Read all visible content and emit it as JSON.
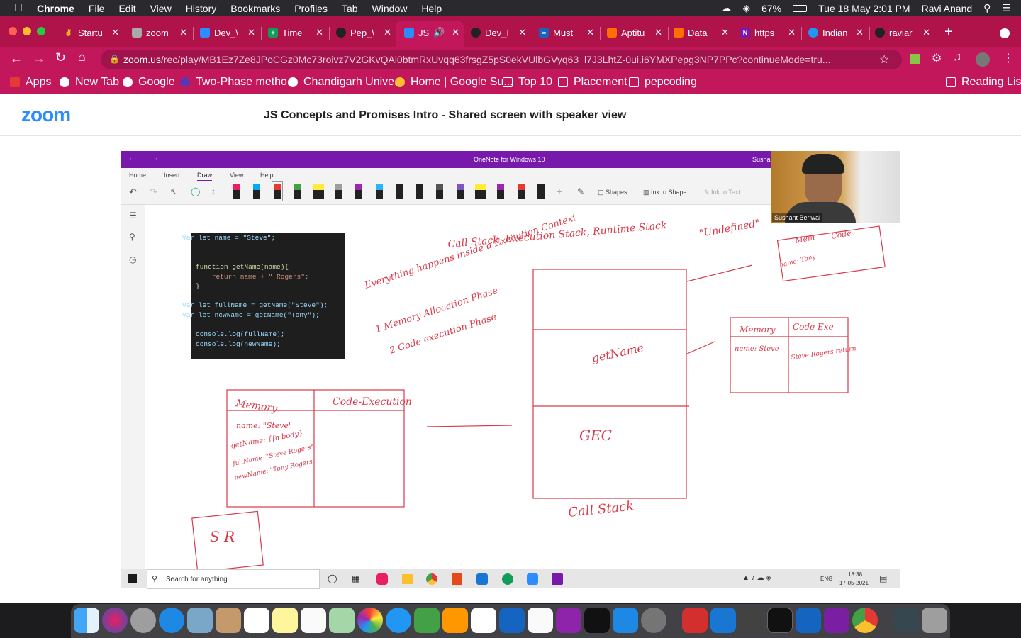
{
  "menubar": {
    "items": [
      "Chrome",
      "File",
      "Edit",
      "View",
      "History",
      "Bookmarks",
      "Profiles",
      "Tab",
      "Window",
      "Help"
    ],
    "battery": "67%",
    "datetime": "Tue 18 May  2:01 PM",
    "user": "Ravi Anand"
  },
  "tabs": [
    {
      "label": "Startu",
      "color": "#333"
    },
    {
      "label": "zoom",
      "color": "#888"
    },
    {
      "label": "Dev_\\",
      "color": "#2d8cff"
    },
    {
      "label": "Time",
      "color": "#0f9d58"
    },
    {
      "label": "Pep_\\",
      "color": "#222"
    },
    {
      "label": "JS",
      "color": "#2d8cff"
    },
    {
      "label": "Dev_I",
      "color": "#222"
    },
    {
      "label": "Must",
      "color": "#1565c0"
    },
    {
      "label": "Aptitu",
      "color": "#ff6f00"
    },
    {
      "label": "Data",
      "color": "#ff6f00"
    },
    {
      "label": "https",
      "color": "#7719aa"
    },
    {
      "label": "Indian",
      "color": "#2196f3"
    },
    {
      "label": "raviar",
      "color": "#222"
    }
  ],
  "url": {
    "host": "zoom.us",
    "path": "/rec/play/MB1Ez7Ze8JPoCGz0Mc73roivz7V2GKvQAi0btmRxUvqq63frsgZ5pS0ekVUlbGVyq63_l7J3LhtZ-0ui.i6YMXPepg3NP7PPc?continueMode=tru..."
  },
  "bookmarks": [
    {
      "label": "Apps",
      "color": "#e53935"
    },
    {
      "label": "New Tab",
      "color": "#fff"
    },
    {
      "label": "Google",
      "color": "#fff"
    },
    {
      "label": "Two-Phase metho...",
      "color": "#5e35b1"
    },
    {
      "label": "Chandigarh Unive...",
      "color": "#fff"
    },
    {
      "label": "Home | Google Su...",
      "color": "#fbc02d"
    },
    {
      "label": "Top 10",
      "color": "#fff"
    },
    {
      "label": "Placement",
      "color": "#fff"
    },
    {
      "label": "pepcoding",
      "color": "#fff"
    }
  ],
  "reading_list": "Reading List",
  "zoom": {
    "logo": "zoom",
    "title": "JS Concepts and Promises Intro - Shared screen with speaker view"
  },
  "onenote": {
    "title": "OneNote for Windows 10",
    "user": "Sushan",
    "tabs": [
      "Home",
      "Insert",
      "Draw",
      "View",
      "Help"
    ],
    "active_tab": "Draw",
    "shapes": "Shapes",
    "ink_to_shape": "Ink to Shape",
    "ink_to_text": "Ink to Text",
    "speaker": "Sushant Beriwal"
  },
  "code": [
    "Var let name = \"Steve\";",
    "",
    "function getName(name){",
    "    return name + \" Rogers\";",
    "}",
    "",
    "Var let fullName = getName(\"Steve\");",
    "Var let newName = getName(\"Tony\");",
    "",
    "console.log(fullName);",
    "console.log(newName);"
  ],
  "notes": {
    "callstack_title": "Call Stack, Execution Stack, Runtime Stack",
    "undefined": "\"Undefined\"",
    "point1": "Everything happens inside a Execution Context",
    "point2": "1 Memory Allocation Phase",
    "point3": "2 Code execution Phase",
    "memory": "Memory",
    "code_exec": "Code-Execution",
    "mem_name": "name: \"Steve\"",
    "mem_getname": "getName: {fn body}",
    "mem_fullname": "fullName: \"Steve Rogers\"",
    "mem_newname": "newName: \"Tony Rogers\"",
    "gec": "GEC",
    "getname_frame": "getName",
    "call_stack": "Call Stack",
    "mem2": "Memory",
    "code2": "Code Exe",
    "mem2_name": "name: Steve",
    "code2_val": "Steve Rogers return",
    "mem3": "Mem",
    "code3": "Code",
    "mem3_name": "name: Tony",
    "sr": "S R"
  },
  "taskbar": {
    "search": "Search for anything",
    "lang": "ENG",
    "time": "18:38",
    "date": "17-05-2021"
  }
}
